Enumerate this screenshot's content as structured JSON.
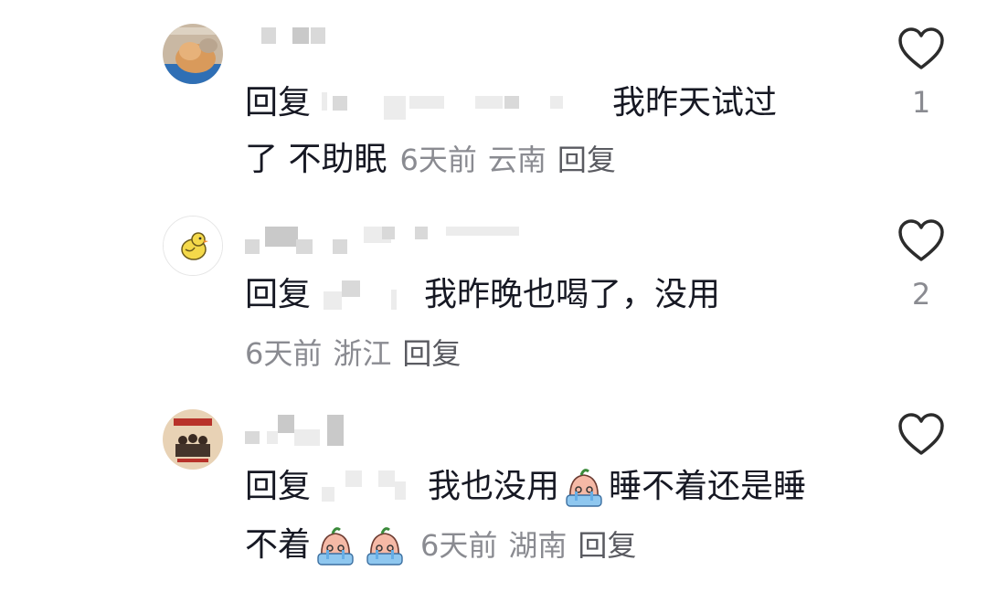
{
  "comments": [
    {
      "reply_prefix": "回复",
      "text_line1": "我昨天试过",
      "text_line2": "了 不助眠",
      "time": "6天前",
      "location": "云南",
      "reply_action": "回复",
      "likes": "1",
      "avatar_icon": "cat-photo-avatar"
    },
    {
      "reply_prefix": "回复",
      "text_line1": "我昨晚也喝了，没用",
      "time": "6天前",
      "location": "浙江",
      "reply_action": "回复",
      "likes": "2",
      "avatar_icon": "chick-avatar"
    },
    {
      "reply_prefix": "回复",
      "text_line1_a": "我也没用",
      "text_line1_b": "睡不着还是睡",
      "text_line2": "不着",
      "time": "6天前",
      "location": "湖南",
      "reply_action": "回复",
      "avatar_icon": "poster-avatar",
      "emoji_icon": "crying-face-emoji"
    }
  ],
  "colors": {
    "text": "#161823",
    "meta": "#8a8b91",
    "heart": "#2c2c2c"
  }
}
